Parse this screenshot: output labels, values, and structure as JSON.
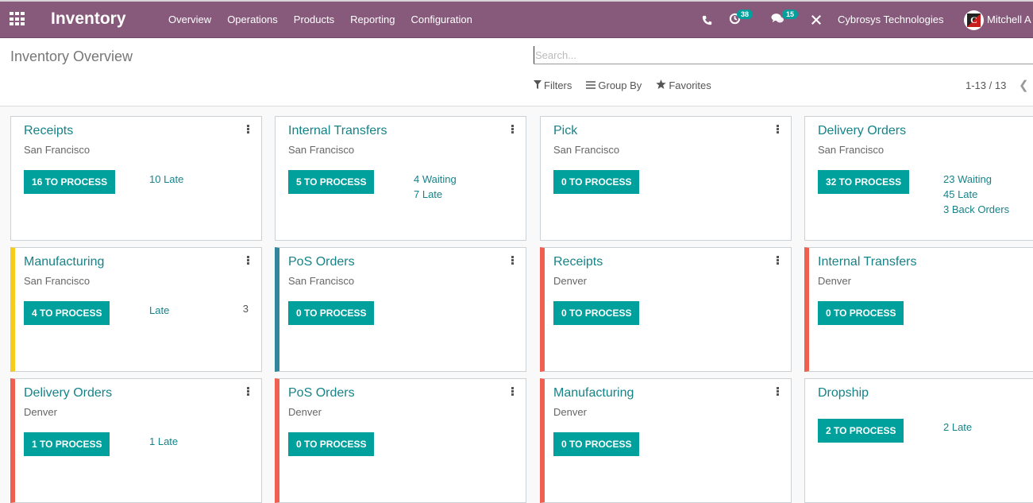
{
  "topbar": {
    "app_name": "Inventory",
    "menu": [
      "Overview",
      "Operations",
      "Products",
      "Reporting",
      "Configuration"
    ],
    "activity_badge": "38",
    "messages_badge": "15",
    "company": "Cybrosys Technologies",
    "user": "Mitchell A",
    "avatar_letter": "C"
  },
  "control": {
    "page_title": "Inventory Overview",
    "search_placeholder": "Search...",
    "filters_label": "Filters",
    "group_by_label": "Group By",
    "favorites_label": "Favorites",
    "pager": "1-13 / 13"
  },
  "colors": {
    "brand": "#875a7b",
    "accent": "#00a09d",
    "title": "#168389",
    "yellow": "#f4cc1b",
    "blue": "#30869b",
    "red": "#f06050"
  },
  "cards": [
    {
      "title": "Receipts",
      "warehouse": "San Francisco",
      "button": "16 TO PROCESS",
      "stats": [
        "10 Late"
      ],
      "count": "",
      "color": ""
    },
    {
      "title": "Internal Transfers",
      "warehouse": "San Francisco",
      "button": "5 TO PROCESS",
      "stats": [
        "4 Waiting",
        "7 Late"
      ],
      "count": "",
      "color": ""
    },
    {
      "title": "Pick",
      "warehouse": "San Francisco",
      "button": "0 TO PROCESS",
      "stats": [],
      "count": "",
      "color": ""
    },
    {
      "title": "Delivery Orders",
      "warehouse": "San Francisco",
      "button": "32 TO PROCESS",
      "stats": [
        "23 Waiting",
        "45 Late",
        "3 Back Orders"
      ],
      "count": "",
      "color": ""
    },
    {
      "title": "Manufacturing",
      "warehouse": "San Francisco",
      "button": "4 TO PROCESS",
      "stats": [
        "Late"
      ],
      "count": "3",
      "color": "#f4cc1b"
    },
    {
      "title": "PoS Orders",
      "warehouse": "San Francisco",
      "button": "0 TO PROCESS",
      "stats": [],
      "count": "",
      "color": "#30869b"
    },
    {
      "title": "Receipts",
      "warehouse": "Denver",
      "button": "0 TO PROCESS",
      "stats": [],
      "count": "",
      "color": "#f06050"
    },
    {
      "title": "Internal Transfers",
      "warehouse": "Denver",
      "button": "0 TO PROCESS",
      "stats": [],
      "count": "",
      "color": "#f06050"
    },
    {
      "title": "Delivery Orders",
      "warehouse": "Denver",
      "button": "1 TO PROCESS",
      "stats": [
        "1 Late"
      ],
      "count": "",
      "color": "#f06050"
    },
    {
      "title": "PoS Orders",
      "warehouse": "Denver",
      "button": "0 TO PROCESS",
      "stats": [],
      "count": "",
      "color": "#f06050"
    },
    {
      "title": "Manufacturing",
      "warehouse": "Denver",
      "button": "0 TO PROCESS",
      "stats": [],
      "count": "",
      "color": "#f06050"
    },
    {
      "title": "Dropship",
      "warehouse": "",
      "button": "2 TO PROCESS",
      "stats": [
        "2 Late"
      ],
      "count": "",
      "color": ""
    }
  ]
}
